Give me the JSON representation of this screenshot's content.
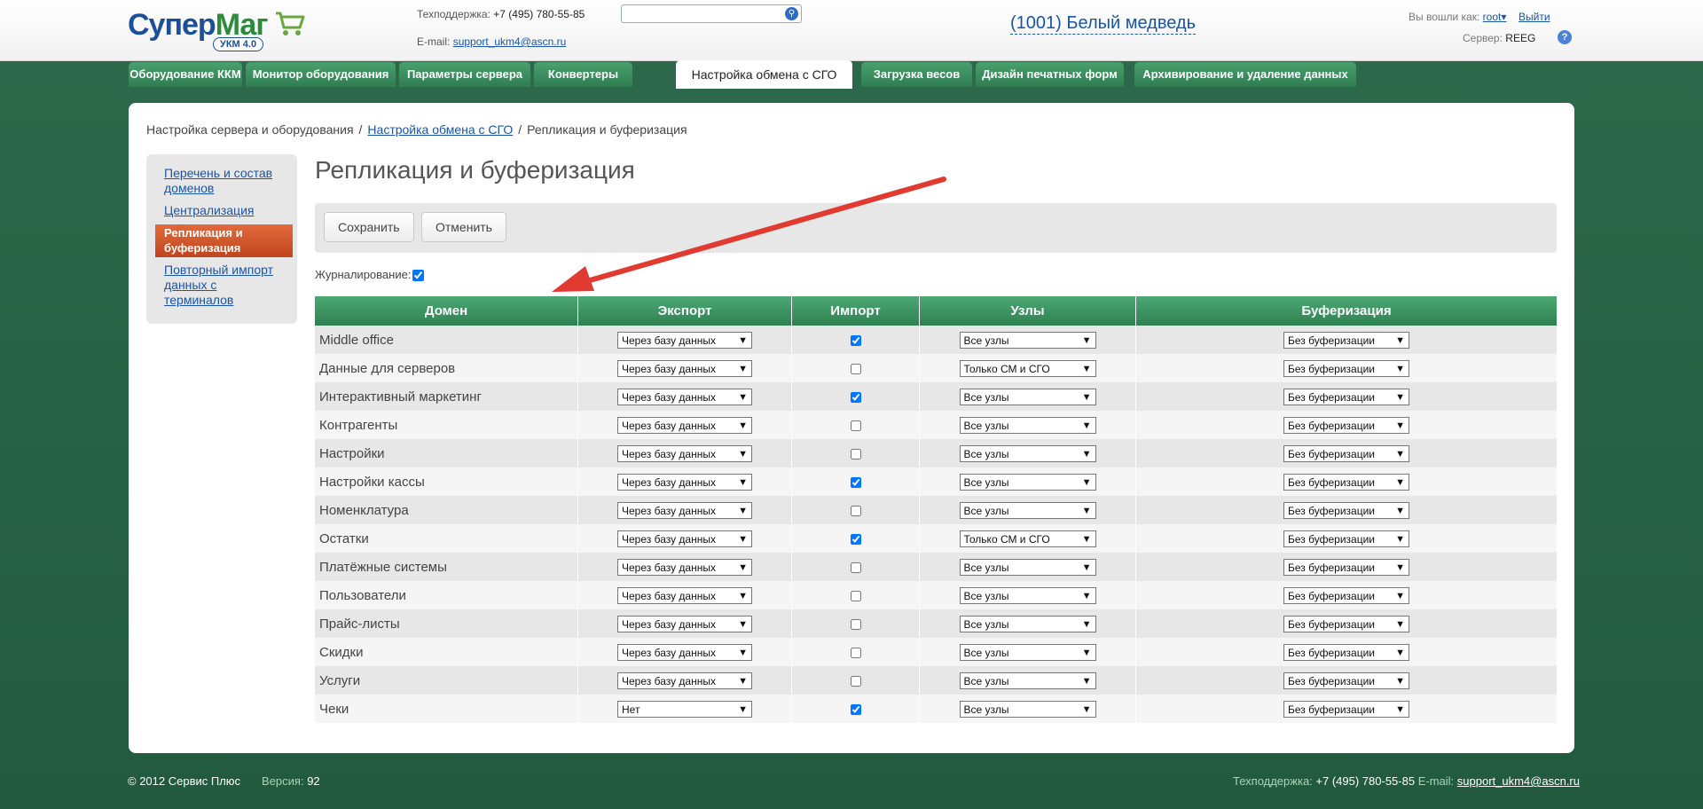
{
  "header": {
    "logo_main": "Супер",
    "logo_accent": "Маг",
    "logo_badge": "УКМ 4.0",
    "support_label": "Техподдержка:",
    "support_phone": "+7 (495) 780-55-85",
    "email_label": "E-mail:",
    "email": "support_ukm4@ascn.ru",
    "search_value": "",
    "store": "(1001) Белый медведь",
    "logged_in_label": "Вы вошли как:",
    "user": "root",
    "logout": "Выйти",
    "server_label": "Сервер:",
    "server": "REEG"
  },
  "tabs": [
    {
      "label": "Оборудование ККМ"
    },
    {
      "label": "Монитор оборудования"
    },
    {
      "label": "Параметры сервера"
    },
    {
      "label": "Конвертеры"
    },
    {
      "label": "Настройка обмена с СГО"
    },
    {
      "label": "Загрузка весов"
    },
    {
      "label": "Дизайн печатных форм"
    },
    {
      "label": "Архивирование и удаление данных"
    }
  ],
  "breadcrumb": {
    "root": "Настройка сервера и оборудования",
    "link": "Настройка обмена с СГО",
    "current": "Репликация и буферизация",
    "sep": "/"
  },
  "sidebar": {
    "items": [
      {
        "label": "Перечень и состав доменов"
      },
      {
        "label": "Централизация"
      },
      {
        "label": "Репликация и буферизация"
      },
      {
        "label": "Повторный импорт данных с терминалов"
      }
    ]
  },
  "page_title": "Репликация и буферизация",
  "toolbar": {
    "save": "Сохранить",
    "cancel": "Отменить"
  },
  "journal_label": "Журналирование:",
  "journal_checked": true,
  "table": {
    "headers": [
      "Домен",
      "Экспорт",
      "Импорт",
      "Узлы",
      "Буферизация"
    ],
    "rows": [
      {
        "domain": "Middle office",
        "export": "Через базу данных",
        "import": true,
        "nodes": "Все узлы",
        "buffer": "Без буферизации"
      },
      {
        "domain": "Данные для серверов",
        "export": "Через базу данных",
        "import": false,
        "nodes": "Только СМ и СГО",
        "buffer": "Без буферизации"
      },
      {
        "domain": "Интерактивный маркетинг",
        "export": "Через базу данных",
        "import": true,
        "nodes": "Все узлы",
        "buffer": "Без буферизации"
      },
      {
        "domain": "Контрагенты",
        "export": "Через базу данных",
        "import": false,
        "nodes": "Все узлы",
        "buffer": "Без буферизации"
      },
      {
        "domain": "Настройки",
        "export": "Через базу данных",
        "import": false,
        "nodes": "Все узлы",
        "buffer": "Без буферизации"
      },
      {
        "domain": "Настройки кассы",
        "export": "Через базу данных",
        "import": true,
        "nodes": "Все узлы",
        "buffer": "Без буферизации"
      },
      {
        "domain": "Номенклатура",
        "export": "Через базу данных",
        "import": false,
        "nodes": "Все узлы",
        "buffer": "Без буферизации"
      },
      {
        "domain": "Остатки",
        "export": "Через базу данных",
        "import": true,
        "nodes": "Только СМ и СГО",
        "buffer": "Без буферизации"
      },
      {
        "domain": "Платёжные системы",
        "export": "Через базу данных",
        "import": false,
        "nodes": "Все узлы",
        "buffer": "Без буферизации"
      },
      {
        "domain": "Пользователи",
        "export": "Через базу данных",
        "import": false,
        "nodes": "Все узлы",
        "buffer": "Без буферизации"
      },
      {
        "domain": "Прайс-листы",
        "export": "Через базу данных",
        "import": false,
        "nodes": "Все узлы",
        "buffer": "Без буферизации"
      },
      {
        "domain": "Скидки",
        "export": "Через базу данных",
        "import": false,
        "nodes": "Все узлы",
        "buffer": "Без буферизации"
      },
      {
        "domain": "Услуги",
        "export": "Через базу данных",
        "import": false,
        "nodes": "Все узлы",
        "buffer": "Без буферизации"
      },
      {
        "domain": "Чеки",
        "export": "Нет",
        "import": true,
        "nodes": "Все узлы",
        "buffer": "Без буферизации"
      }
    ]
  },
  "footer": {
    "copyright": "© 2012 Сервис Плюс",
    "version_label": "Версия:",
    "version": "92",
    "support_label": "Техподдержка:",
    "support_phone": "+7 (495) 780-55-85",
    "email_label": "E-mail:",
    "email": "support_ukm4@ascn.ru"
  },
  "colors": {
    "brand_green": "#2e8150",
    "accent_orange": "#d4562b",
    "link_blue": "#1a55a8",
    "arrow_red": "#e03a31"
  }
}
